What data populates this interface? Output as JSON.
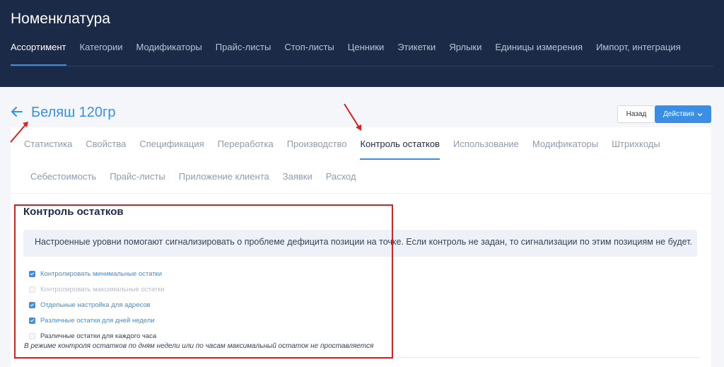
{
  "app": {
    "title": "Номенклатура",
    "nav": [
      "Ассортимент",
      "Категории",
      "Модификаторы",
      "Прайс-листы",
      "Стоп-листы",
      "Ценники",
      "Этикетки",
      "Ярлыки",
      "Единицы измерения",
      "Импорт, интеграция"
    ]
  },
  "page": {
    "title": "Беляш 120гр",
    "buttons": {
      "back": "Назад",
      "actions": "Действия"
    }
  },
  "tabs": {
    "row1": [
      "Статистика",
      "Свойства",
      "Спецификация",
      "Переработка",
      "Производство",
      "Контроль остатков",
      "Использование",
      "Модификаторы",
      "Штрихкоды"
    ],
    "row2": [
      "Себестоимость",
      "Прайс-листы",
      "Приложение клиента",
      "Заявки",
      "Расход"
    ],
    "active": "Контроль остатков"
  },
  "section": {
    "title": "Контроль остатков",
    "info": "Настроенные уровни помогают сигнализировать о проблеме дефицита позиции на точке. Если контроль не задан, то сигнализации по этим позициям не будет.",
    "checkboxes": [
      {
        "label": "Контролировать минимальные остатки",
        "checked": true,
        "disabled": false
      },
      {
        "label": "Контролировать максимальные остатки",
        "checked": false,
        "disabled": true
      },
      {
        "label": "Отдельные настройка для адресов",
        "checked": true,
        "disabled": false
      },
      {
        "label": "Различные остатки для дней недели",
        "checked": true,
        "disabled": false
      },
      {
        "label": "Различные остатки для каждого часа",
        "checked": false,
        "disabled": false
      }
    ],
    "note": "В режиме контроля остатков по дням недели или по часам максимальный остаток не проставляется"
  },
  "colors": {
    "header": "#1b2a47",
    "accent": "#3a8ee6",
    "annotation": "#e11d1d"
  },
  "icons": {
    "back": "arrow-left-icon",
    "dropdown": "chevron-down-icon"
  }
}
